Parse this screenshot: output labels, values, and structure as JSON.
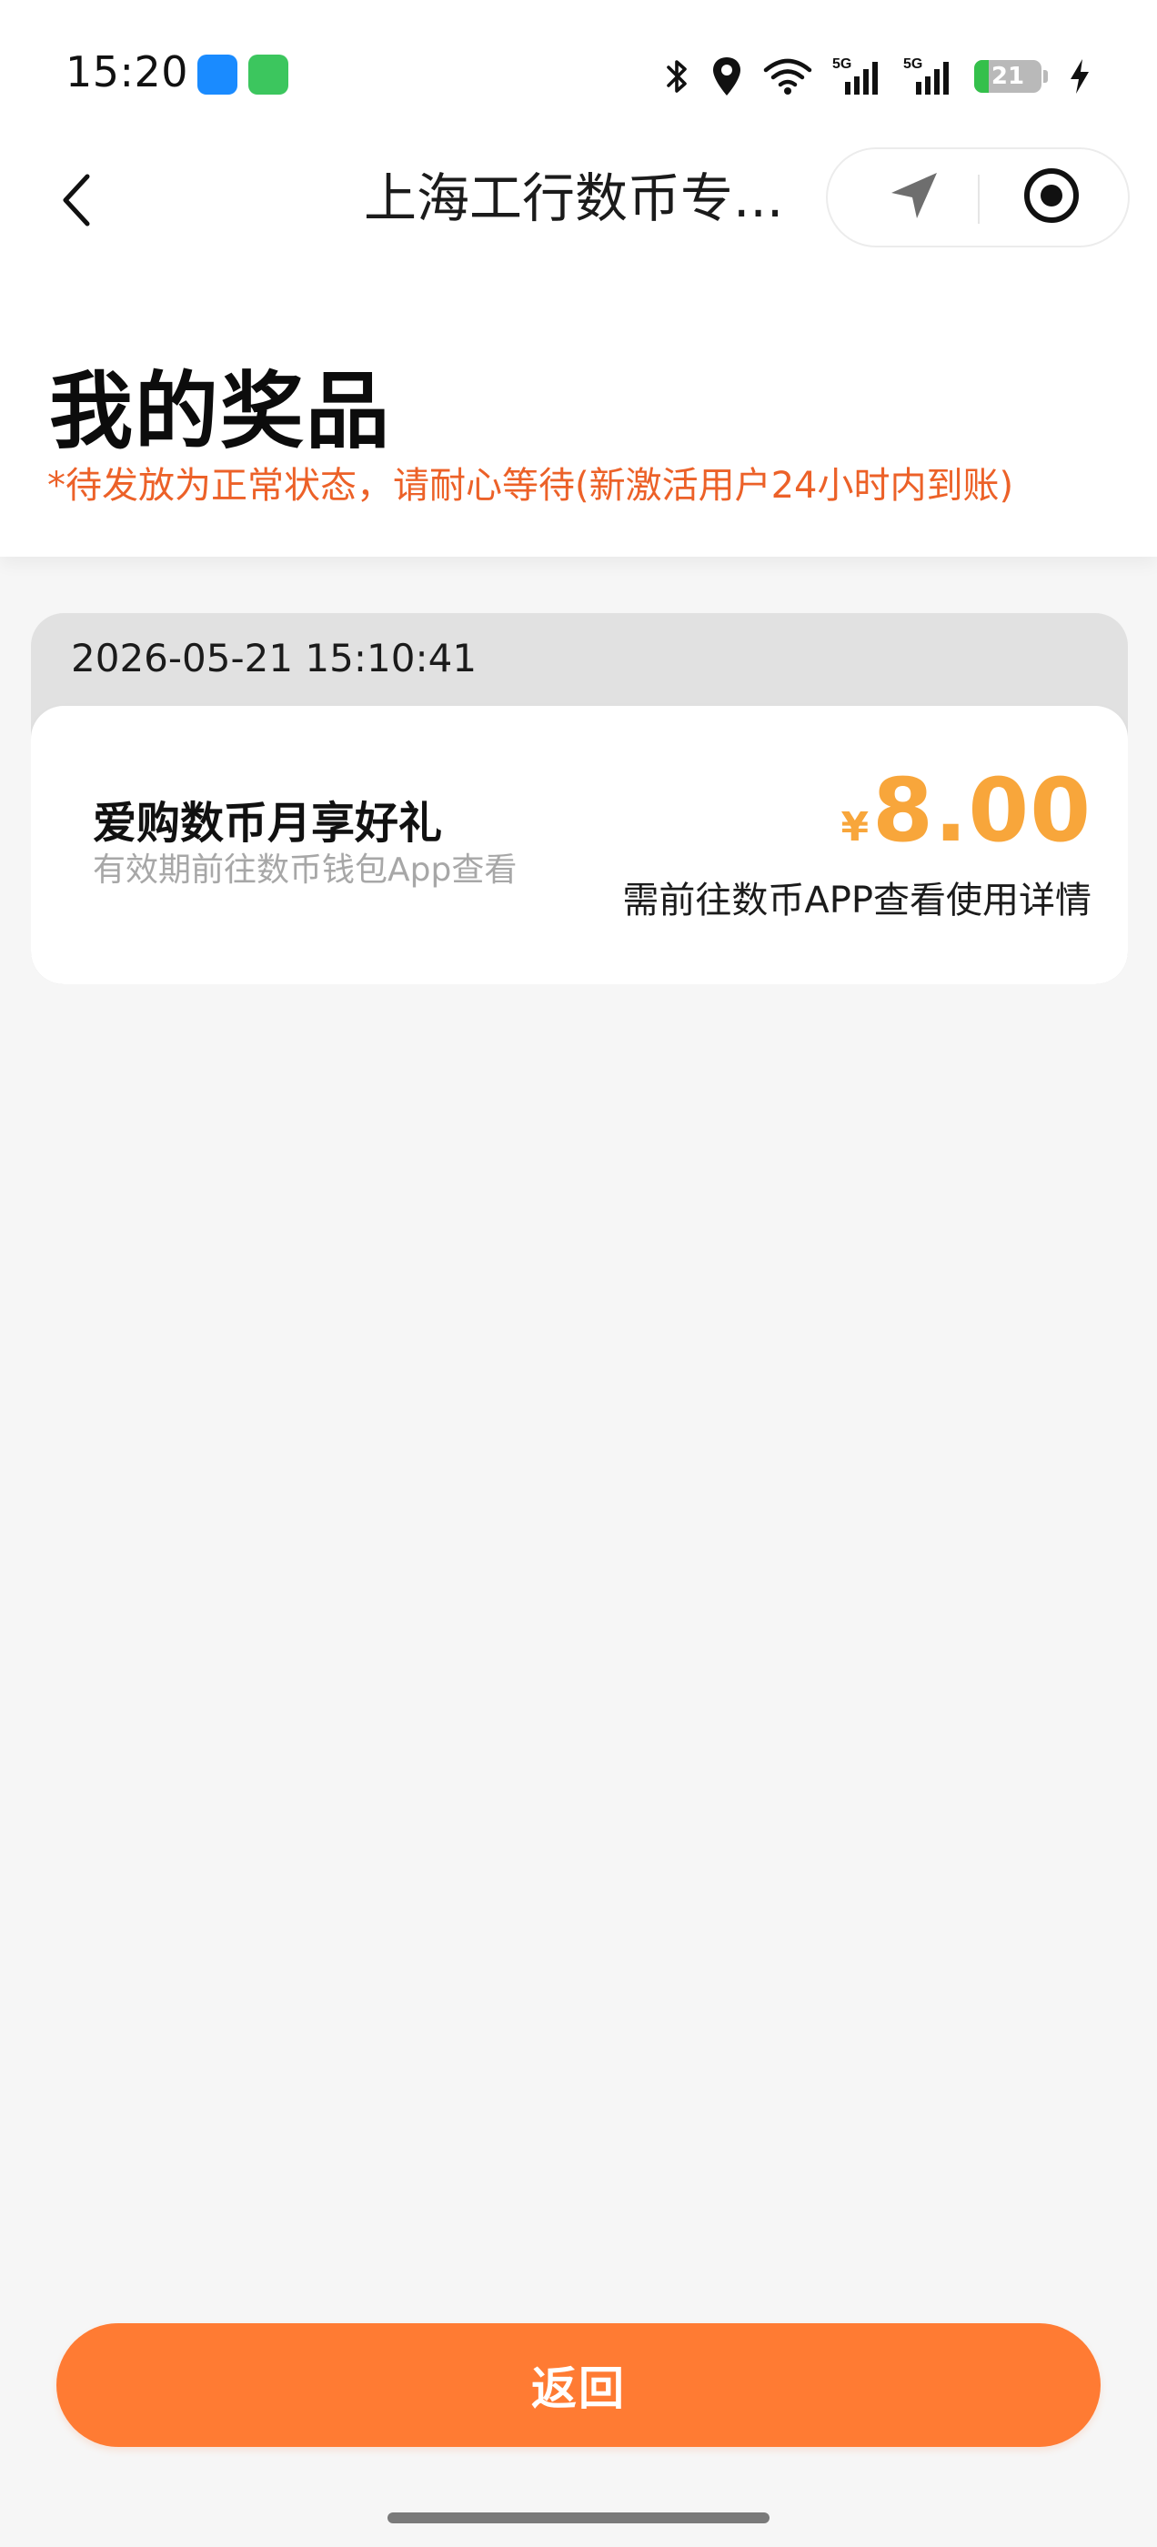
{
  "status_bar": {
    "time": "15:20",
    "battery_level": "21",
    "battery_fraction": 0.21,
    "network_1": "5G",
    "network_2": "5G",
    "icons": [
      "bluetooth-icon",
      "location-pin-icon",
      "wifi-icon",
      "signal-5g-icon",
      "signal-5g-icon",
      "battery-icon",
      "charging-icon"
    ]
  },
  "nav": {
    "title": "上海工行数币专...",
    "back_icon": "chevron-left-icon",
    "capsule_icons": [
      "location-arrow-icon",
      "record-icon"
    ]
  },
  "header": {
    "title": "我的奖品",
    "note": "*待发放为正常状态，请耐心等待(新激活用户24小时内到账)"
  },
  "prizes": [
    {
      "date": "2026-05-21 15:10:41",
      "name": "爱购数币月享好礼",
      "validity": "有效期前往数币钱包App查看",
      "currency": "¥",
      "amount": "8.00",
      "usage": "需前往数币APP查看使用详情"
    }
  ],
  "footer": {
    "return_label": "返回"
  },
  "colors": {
    "accent_orange": "#ff7b33",
    "note_orange": "#ec6128",
    "amount_gold": "#f8a63b",
    "page_bg": "#f6f6f6"
  }
}
